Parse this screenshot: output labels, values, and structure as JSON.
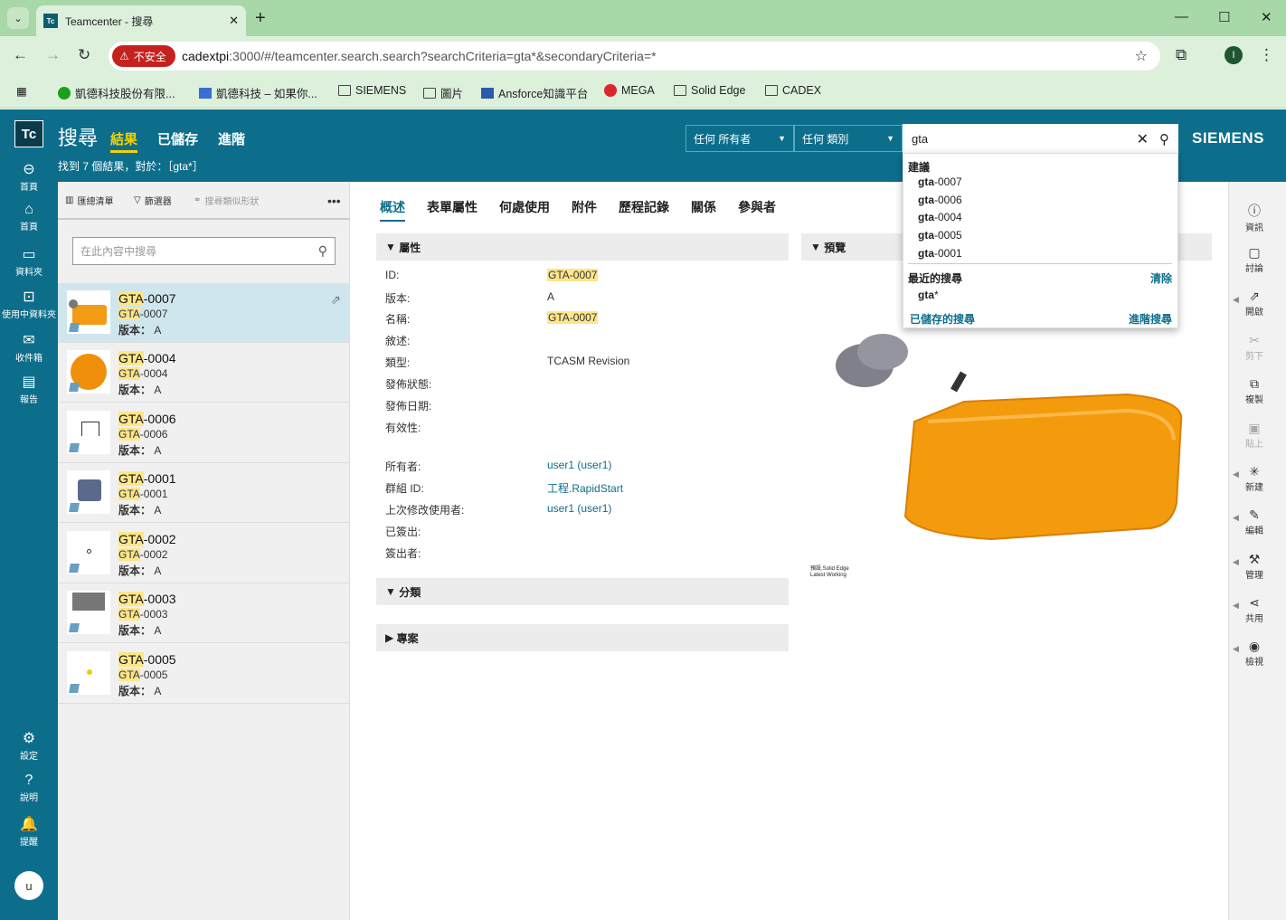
{
  "browser": {
    "tab_title": "Teamcenter - 搜尋",
    "tab_favicon": "Tc",
    "insecure_label": "不安全",
    "url_host": "cadextpi",
    "url_rest": ":3000/#/teamcenter.search.search?searchCriteria=gta*&secondaryCriteria=*",
    "bookmarks": [
      "凱德科技股份有限...",
      "凱德科技 – 如果你...",
      "SIEMENS",
      "圖片",
      "Ansforce知識平台",
      "MEGA",
      "Solid Edge",
      "CADEX"
    ]
  },
  "app": {
    "logo": "Tc",
    "title": "搜尋",
    "nav": [
      "結果",
      "已儲存",
      "進階"
    ],
    "result_summary": "找到 7 個結果，對於：［gta*］",
    "owner_filter": "任何 所有者",
    "type_filter": "任何 類別",
    "search_value": "gta",
    "brand": "SIEMENS"
  },
  "leftnav": [
    "首頁",
    "首頁",
    "資料夾",
    "使用中資料夾",
    "收件箱",
    "報告",
    "設定",
    "說明",
    "提醒"
  ],
  "user_initial": "u",
  "list_toolbar": {
    "list": "匯總清單",
    "filter": "篩選器",
    "shape": "搜尋類似形狀"
  },
  "list_filter_placeholder": "在此內容中搜尋",
  "rev_label": "版本：",
  "items": [
    {
      "hl": "GTA",
      "rest": "-0007",
      "rev": "A"
    },
    {
      "hl": "GTA",
      "rest": "-0004",
      "rev": "A"
    },
    {
      "hl": "GTA",
      "rest": "-0006",
      "rev": "A"
    },
    {
      "hl": "GTA",
      "rest": "-0001",
      "rev": "A"
    },
    {
      "hl": "GTA",
      "rest": "-0002",
      "rev": "A"
    },
    {
      "hl": "GTA",
      "rest": "-0003",
      "rev": "A"
    },
    {
      "hl": "GTA",
      "rest": "-0005",
      "rev": "A"
    }
  ],
  "tabs": [
    "概述",
    "表單屬性",
    "何處使用",
    "附件",
    "歷程記錄",
    "關係",
    "參與者"
  ],
  "sections": {
    "properties": "屬性",
    "preview": "預覽",
    "classification": "分類",
    "project": "專案"
  },
  "properties": {
    "id_label": "ID:",
    "id": "GTA-0007",
    "rev_label": "版本:",
    "rev": "A",
    "name_label": "名稱:",
    "name": "GTA-0007",
    "desc_label": "敘述:",
    "type_label": "類型:",
    "type": "TCASM Revision",
    "release_status_label": "發佈狀態:",
    "release_date_label": "發佈日期:",
    "effectivity_label": "有效性:",
    "owner_label": "所有者:",
    "owner": "user1 (user1)",
    "group_label": "群組 ID:",
    "group": "工程.RapidStart",
    "modifier_label": "上次修改使用者:",
    "modifier": "user1 (user1)",
    "checked_out_label": "已簽出:",
    "checked_out_by_label": "簽出者:"
  },
  "preview_caption_1": "預設,Solid Edge",
  "preview_caption_2": "Latest Working",
  "rightnav": [
    "資訊",
    "討論",
    "開啟",
    "剪下",
    "複製",
    "貼上",
    "新建",
    "編輯",
    "管理",
    "共用",
    "檢視"
  ],
  "suggest": {
    "head": "建議",
    "items": [
      {
        "b": "gta",
        "r": "-0007"
      },
      {
        "b": "gta",
        "r": "-0006"
      },
      {
        "b": "gta",
        "r": "-0004"
      },
      {
        "b": "gta",
        "r": "-0005"
      },
      {
        "b": "gta",
        "r": "-0001"
      }
    ],
    "recent_head": "最近的搜尋",
    "clear": "清除",
    "recent_b": "gta",
    "recent_r": "*",
    "saved": "已儲存的搜尋",
    "advanced": "進階搜尋"
  },
  "colors": {
    "header": "#0d6e8c",
    "highlight": "#fde68a",
    "accent": "#f5d100",
    "chrome": "#dcf0dc"
  }
}
